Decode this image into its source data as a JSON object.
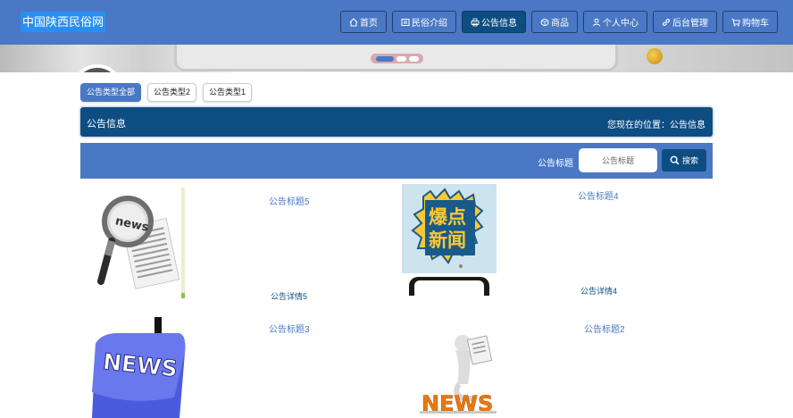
{
  "header": {
    "logo": "中国陕西民俗网",
    "nav": [
      {
        "label": "首页",
        "icon": "home-icon"
      },
      {
        "label": "民俗介绍",
        "icon": "list-icon"
      },
      {
        "label": "公告信息",
        "icon": "print-icon",
        "active": true
      },
      {
        "label": "商品",
        "icon": "box-icon"
      },
      {
        "label": "个人中心",
        "icon": "user-icon"
      },
      {
        "label": "后台管理",
        "icon": "link-icon"
      },
      {
        "label": "购物车",
        "icon": "cart-icon"
      }
    ]
  },
  "banner": {
    "slides_count": 3,
    "active_slide": 1
  },
  "types": [
    {
      "label": "公告类型全部",
      "active": true
    },
    {
      "label": "公告类型2"
    },
    {
      "label": "公告类型1"
    }
  ],
  "title_bar": {
    "title": "公告信息",
    "location": "您现在的位置：公告信息"
  },
  "search": {
    "label": "公告标题",
    "placeholder": "公告标题",
    "button": "搜索"
  },
  "cards": [
    {
      "title": "公告标题5",
      "detail": "公告详情5",
      "image": "magnifier-news-image"
    },
    {
      "title": "公告标题4",
      "detail": "公告详情4",
      "image": "breaking-news-phone-image"
    },
    {
      "title": "公告标题3",
      "detail": "",
      "image": "news-key-image"
    },
    {
      "title": "公告标题2",
      "detail": "",
      "image": "news-figure-image"
    }
  ],
  "colors": {
    "primary": "#4a78c4",
    "dark": "#0d4d82",
    "logo_bg": "#2a8ef0"
  }
}
